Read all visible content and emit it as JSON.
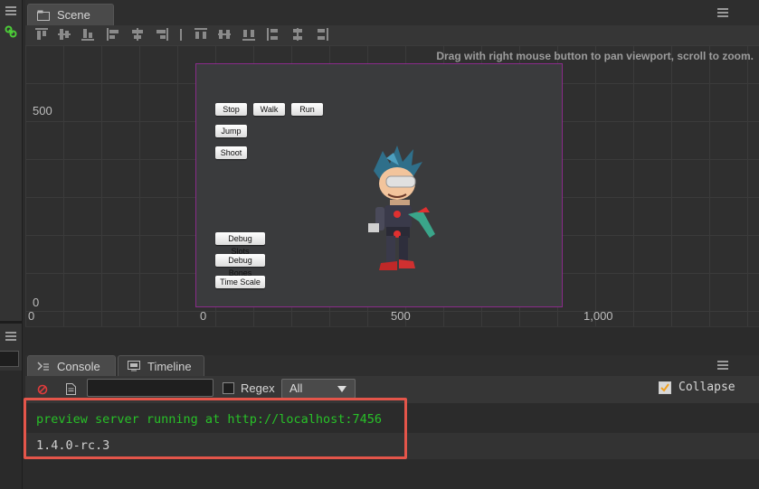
{
  "scene": {
    "tab_label": "Scene",
    "hint": "Drag with right mouse button to pan viewport, scroll to zoom.",
    "y_axis_labels": [
      "500",
      "0"
    ],
    "x_axis_labels": [
      "0",
      "0",
      "500",
      "1,000"
    ]
  },
  "game": {
    "buttons": {
      "stop": "Stop",
      "walk": "Walk",
      "run": "Run",
      "jump": "Jump",
      "shoot": "Shoot",
      "debug_slots": "Debug Slots",
      "debug_bones": "Debug Bones",
      "time_scale": "Time Scale"
    }
  },
  "console": {
    "tabs": [
      "Console",
      "Timeline"
    ],
    "filter_value": "",
    "regex_label": "Regex",
    "regex_checked": false,
    "level_selected": "All",
    "collapse_label": "Collapse",
    "collapse_checked": true,
    "logs": [
      {
        "text": "preview server running at http://localhost:7456",
        "color": "#28c128"
      },
      {
        "text": "1.4.0-rc.3",
        "color": "#d0d0d0"
      }
    ]
  },
  "colors": {
    "accent_link": "#4ccc38",
    "highlight_border": "#e4554a",
    "canvas_border": "#8a2b8a",
    "collapse_check": "#f0a020"
  }
}
